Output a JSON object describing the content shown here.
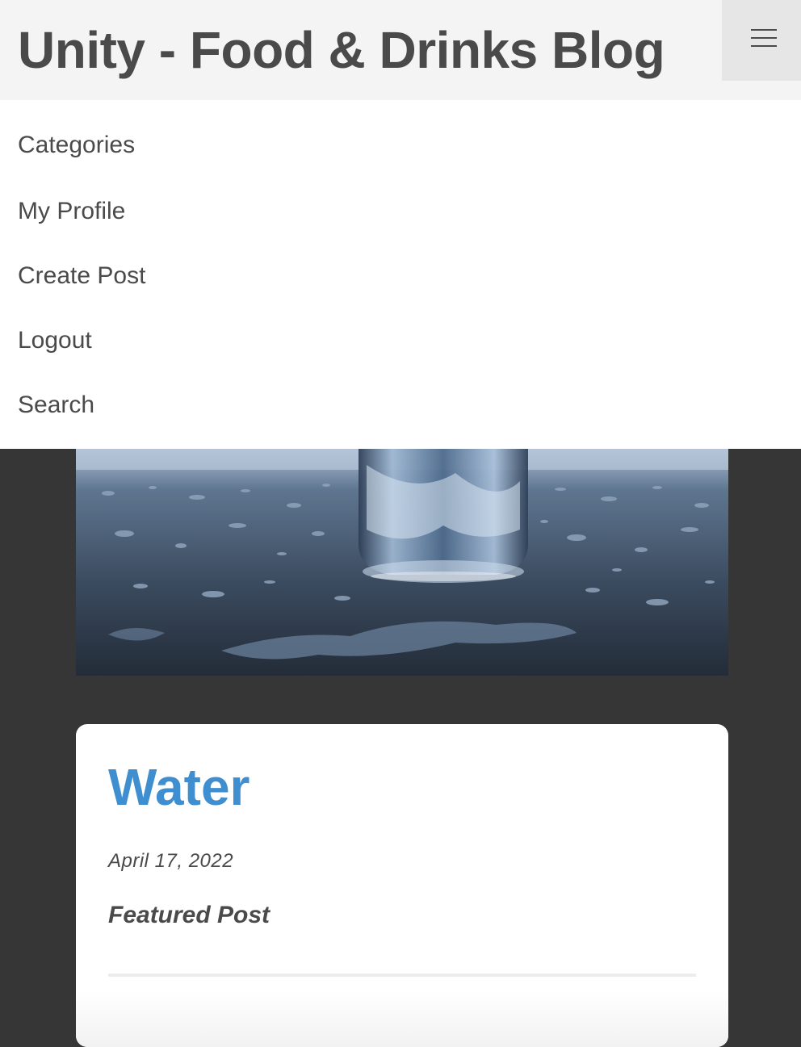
{
  "header": {
    "title": "Unity - Food & Drinks Blog",
    "menu_icon": "hamburger-icon"
  },
  "nav": {
    "items": [
      {
        "label": "Categories"
      },
      {
        "label": "My Profile"
      },
      {
        "label": "Create Post"
      },
      {
        "label": "Logout"
      },
      {
        "label": "Search"
      }
    ]
  },
  "post": {
    "title": "Water",
    "date": "April 17, 2022",
    "featured_label": "Featured Post"
  },
  "colors": {
    "title_accent": "#3e8ed0",
    "text": "#4a4a4a",
    "page_bg": "#363636",
    "header_bg": "#f4f4f4"
  }
}
